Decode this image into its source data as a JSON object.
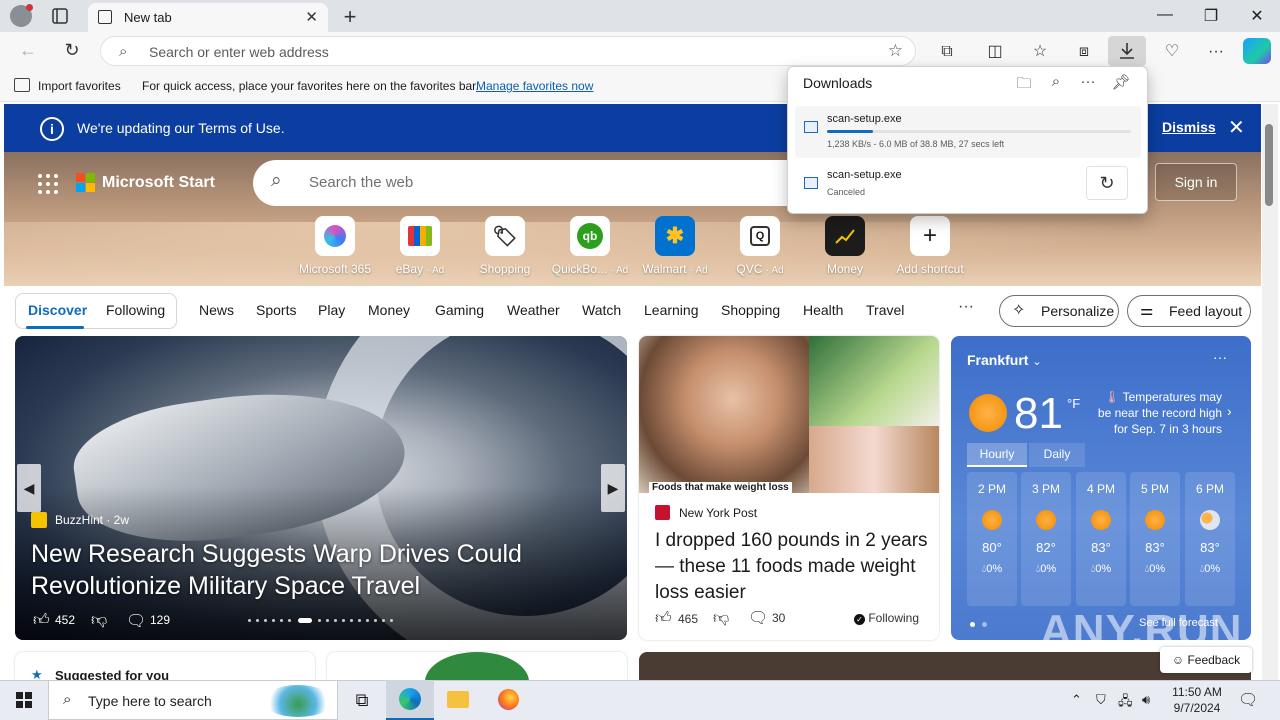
{
  "browser": {
    "tab_title": "New tab",
    "address_placeholder": "Search or enter web address",
    "favorites": {
      "import_label": "Import favorites",
      "message": "For quick access, place your favorites here on the favorites bar.",
      "manage_link": "Manage favorites now"
    }
  },
  "downloads": {
    "title": "Downloads",
    "items": [
      {
        "name": "scan-setup.exe",
        "status": "1,238 KB/s - 6.0 MB of 38.8 MB, 27 secs left",
        "progress": 0.15
      },
      {
        "name": "scan-setup.exe",
        "status": "Canceled"
      }
    ]
  },
  "notice": {
    "text": "We're updating our Terms of Use.",
    "dismiss": "Dismiss"
  },
  "start": {
    "brand": "Microsoft Start",
    "search_placeholder": "Search the web",
    "signin": "Sign in",
    "shortcuts": [
      {
        "label": "Microsoft 365",
        "ad": "",
        "icon": "m365-icon"
      },
      {
        "label": "eBay",
        "ad": "· Ad",
        "icon": "ebay-icon"
      },
      {
        "label": "Shopping",
        "ad": "",
        "icon": "shopping-tag-icon"
      },
      {
        "label": "QuickBo...",
        "ad": "· Ad",
        "icon": "quickbooks-icon"
      },
      {
        "label": "Walmart",
        "ad": "· Ad",
        "icon": "walmart-icon"
      },
      {
        "label": "QVC",
        "ad": "· Ad",
        "icon": "qvc-icon"
      },
      {
        "label": "Money",
        "ad": "",
        "icon": "money-chart-icon"
      },
      {
        "label": "Add shortcut",
        "ad": "",
        "icon": "plus-icon"
      }
    ]
  },
  "feed_nav": {
    "discover": "Discover",
    "following": "Following",
    "items": [
      "News",
      "Sports",
      "Play",
      "Money",
      "Gaming",
      "Weather",
      "Watch",
      "Learning",
      "Shopping",
      "Health",
      "Travel"
    ],
    "more": "···",
    "personalize": "Personalize",
    "feed_layout": "Feed layout"
  },
  "article1": {
    "source": "BuzzHint · 2w",
    "title": "New Research Suggests Warp Drives Could Revolutionize Military Space Travel",
    "likes": "452",
    "comments": "129"
  },
  "article2": {
    "caption": "Foods that make weight loss",
    "source": "New York Post",
    "title": "I dropped 160 pounds in 2 years — these 11 foods made weight loss easier",
    "likes": "465",
    "comments": "30",
    "following": "Following"
  },
  "weather": {
    "city": "Frankfurt",
    "temp": "81",
    "unit": "°F",
    "note": "Temperatures may be near the record high for Sep. 7 in 3 hours",
    "tab_hourly": "Hourly",
    "tab_daily": "Daily",
    "hours": [
      {
        "time": "2 PM",
        "temp": "80°",
        "precip": "0%"
      },
      {
        "time": "3 PM",
        "temp": "82°",
        "precip": "0%"
      },
      {
        "time": "4 PM",
        "temp": "83°",
        "precip": "0%"
      },
      {
        "time": "5 PM",
        "temp": "83°",
        "precip": "0%"
      },
      {
        "time": "6 PM",
        "temp": "83°",
        "precip": "0%"
      }
    ],
    "forecast_link": "See full forecast"
  },
  "lower": {
    "suggested": "Suggested for you",
    "feedback": "Feedback"
  },
  "watermark": "ANY.RUN",
  "taskbar": {
    "search_placeholder": "Type here to search",
    "time": "11:50 AM",
    "date": "9/7/2024"
  },
  "colors": {
    "accent": "#0f6cbd",
    "notice_bg": "#0b3ea0",
    "weather_bg": "#4b7acf"
  }
}
